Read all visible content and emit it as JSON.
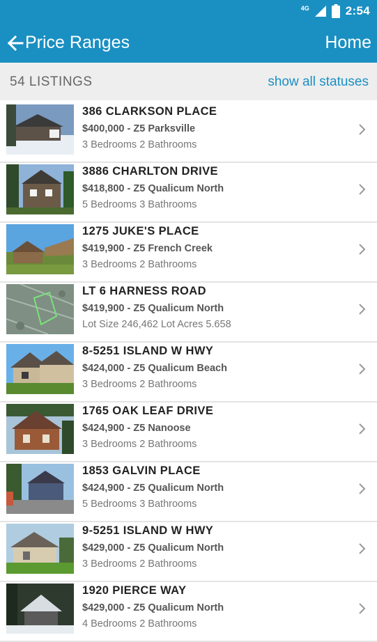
{
  "status_bar": {
    "network": "4G",
    "time": "2:54"
  },
  "app_bar": {
    "title": "Price Ranges",
    "home_label": "Home"
  },
  "summary": {
    "count_label": "54 LISTINGS",
    "filter_link": "show all statuses"
  },
  "listings": [
    {
      "address": "386 CLARKSON PLACE",
      "price_area": "$400,000 - Z5 Parksville",
      "details": "3 Bedrooms 2 Bathrooms"
    },
    {
      "address": "3886 CHARLTON DRIVE",
      "price_area": "$418,800 - Z5 Qualicum North",
      "details": "5 Bedrooms 3 Bathrooms"
    },
    {
      "address": "1275 JUKE'S PLACE",
      "price_area": "$419,900 - Z5 French Creek",
      "details": "3 Bedrooms 2 Bathrooms"
    },
    {
      "address": "LT 6 HARNESS ROAD",
      "price_area": "$419,900 - Z5 Qualicum North",
      "details": "Lot Size 246,462 Lot Acres 5.658"
    },
    {
      "address": "8-5251 ISLAND W HWY",
      "price_area": "$424,000 - Z5 Qualicum Beach",
      "details": "3 Bedrooms 2 Bathrooms"
    },
    {
      "address": "1765 OAK LEAF DRIVE",
      "price_area": "$424,900 - Z5 Nanoose",
      "details": "3 Bedrooms 2 Bathrooms"
    },
    {
      "address": "1853 GALVIN PLACE",
      "price_area": "$424,900 - Z5 Qualicum North",
      "details": "5 Bedrooms 3 Bathrooms"
    },
    {
      "address": "9-5251 ISLAND W HWY",
      "price_area": "$429,000 - Z5 Qualicum North",
      "details": "3 Bedrooms 2 Bathrooms"
    },
    {
      "address": "1920 PIERCE WAY",
      "price_area": "$429,000 - Z5 Qualicum North",
      "details": "4 Bedrooms 2 Bathrooms"
    }
  ],
  "colors": {
    "primary": "#1a8fc2",
    "subheader_bg": "#eeeeee",
    "divider": "#e4e4e4"
  }
}
